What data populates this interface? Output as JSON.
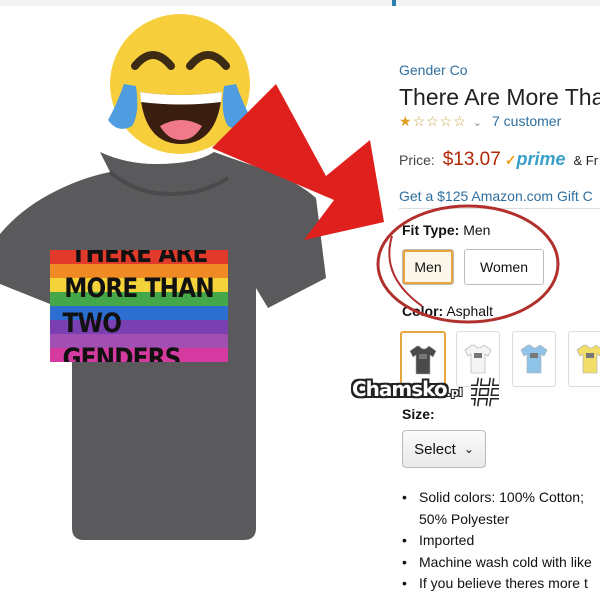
{
  "brand": "Gender Co",
  "product_title": "There Are More Tha",
  "rating": {
    "stars_filled": 1,
    "stars_total": 5,
    "customer_reviews": "7 customer"
  },
  "price": {
    "label": "Price:",
    "amount": "$13.07",
    "prime": "prime",
    "shipping": "& Fr"
  },
  "gift_card": "Get a $125 Amazon.com Gift C",
  "fit_type": {
    "label": "Fit Type:",
    "value": "Men",
    "options": [
      "Men",
      "Women"
    ],
    "selected": "Men"
  },
  "color": {
    "label": "Color:",
    "value": "Asphalt",
    "swatches": [
      {
        "name": "asphalt",
        "color": "#4a4a4a"
      },
      {
        "name": "white",
        "color": "#f4f4f4"
      },
      {
        "name": "light-blue",
        "color": "#8fc3e8"
      },
      {
        "name": "yellow",
        "color": "#f3de6a"
      }
    ]
  },
  "watermark": {
    "text": "Chamsko",
    "suffix": ".pl"
  },
  "size": {
    "label": "Size:",
    "select_label": "Select"
  },
  "shirt_print": {
    "line1": "THERE ARE",
    "line2": "MORE THAN",
    "line3": "TWO GENDERS"
  },
  "flag_colors": [
    "#e23a2a",
    "#f08a24",
    "#f4d23a",
    "#44a84a",
    "#2d6fd0",
    "#7a3fb0",
    "#a24fb4",
    "#d43aa0"
  ],
  "features": [
    "Solid colors: 100% Cotton;",
    "50% Polyester",
    "Imported",
    "Machine wash cold with like",
    "If you believe theres more t"
  ],
  "emoji": "face-with-tears-of-joy",
  "accent_colors": {
    "arrow": "#e0201c",
    "circle": "#b1302e",
    "link": "#2f6f9f",
    "price": "#b12704"
  }
}
